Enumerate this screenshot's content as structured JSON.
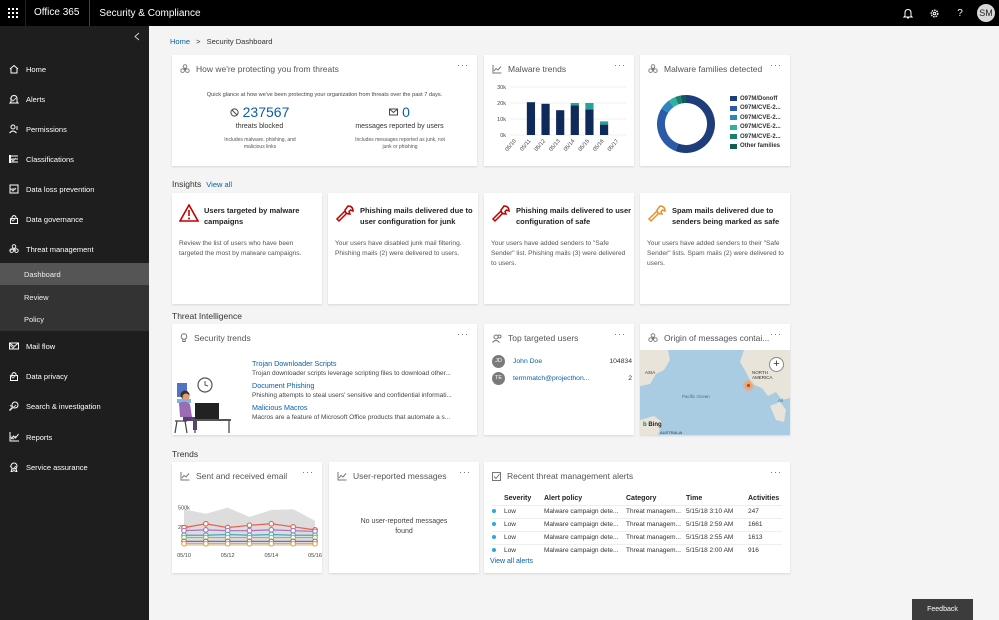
{
  "topbar": {
    "app_name": "Office 365",
    "suite_name": "Security & Compliance",
    "user_initials": "SM"
  },
  "sidebar": {
    "items": [
      {
        "label": "Home",
        "icon": "home-icon",
        "has_chevron": false
      },
      {
        "label": "Alerts",
        "icon": "alert-icon",
        "has_chevron": true
      },
      {
        "label": "Permissions",
        "icon": "permissions-icon",
        "has_chevron": false
      },
      {
        "label": "Classifications",
        "icon": "classifications-icon",
        "has_chevron": true
      },
      {
        "label": "Data loss prevention",
        "icon": "dlp-icon",
        "has_chevron": true
      },
      {
        "label": "Data governance",
        "icon": "lock-icon",
        "has_chevron": true
      },
      {
        "label": "Threat management",
        "icon": "biohazard-icon",
        "has_chevron": true,
        "expanded": true
      },
      {
        "label": "Mail flow",
        "icon": "mail-icon",
        "has_chevron": true
      },
      {
        "label": "Data privacy",
        "icon": "lock-icon",
        "has_chevron": true
      },
      {
        "label": "Search & investigation",
        "icon": "search-icon",
        "has_chevron": true
      },
      {
        "label": "Reports",
        "icon": "chart-icon",
        "has_chevron": true
      },
      {
        "label": "Service assurance",
        "icon": "badge-icon",
        "has_chevron": true
      }
    ],
    "subitems": [
      {
        "label": "Dashboard",
        "active": true
      },
      {
        "label": "Review",
        "active": false
      },
      {
        "label": "Policy",
        "active": false
      }
    ]
  },
  "breadcrumb": {
    "home": "Home",
    "sep": ">",
    "current": "Security Dashboard"
  },
  "protect": {
    "title": "How we're protecting you from threats",
    "intro": "Quick glance at how we've been protecting your organization from threats over the past 7 days.",
    "threats_blocked_value": "237567",
    "threats_blocked_label": "threats blocked",
    "threats_blocked_note": "Includes malware, phishing, and malicious links",
    "reported_value": "0",
    "reported_label": "messages reported by users",
    "reported_note": "Includes messages reported as junk, not junk or phishing"
  },
  "malware_trends": {
    "title": "Malware trends",
    "chart_data": {
      "type": "bar",
      "categories": [
        "05/10",
        "05/11",
        "05/12",
        "05/13",
        "05/14",
        "05/15",
        "05/16",
        "05/17"
      ],
      "ylim": [
        0,
        30000
      ],
      "yticks": [
        "30k",
        "20k",
        "10k",
        "0k"
      ],
      "series": [
        {
          "values": [
            0,
            20500,
            19500,
            15500,
            18500,
            16000,
            6500,
            0
          ],
          "color": "#0e2a5a"
        },
        {
          "values": [
            0,
            0,
            0,
            0,
            1500,
            4000,
            2000,
            0
          ],
          "color": "#2aa198"
        }
      ]
    }
  },
  "malware_families": {
    "title": "Malware families detected",
    "legend": [
      {
        "label": "O97M/Donoff",
        "color": "#1f3d7a"
      },
      {
        "label": "O97M/CVE-2...",
        "color": "#2b5aa8"
      },
      {
        "label": "O97M/CVE-2...",
        "color": "#2e86c1"
      },
      {
        "label": "O97M/CVE-2...",
        "color": "#2bb3a0"
      },
      {
        "label": "O97M/CVE-2...",
        "color": "#1a7f73"
      },
      {
        "label": "Other families",
        "color": "#0f5e55"
      }
    ],
    "chart_data": {
      "type": "pie",
      "labels": [
        "O97M/Donoff",
        "O97M/CVE-2...",
        "O97M/CVE-2...",
        "O97M/CVE-2...",
        "O97M/CVE-2...",
        "Other families"
      ],
      "values": [
        56,
        28,
        6,
        4,
        3,
        3
      ]
    }
  },
  "insights": {
    "title": "Insights",
    "view_all": "View all",
    "cards": [
      {
        "title": "Users targeted by malware campaigns",
        "text": "Review the list of users who have been targeted the most by malware campaigns.",
        "icon": "warning-icon",
        "color": "#c00000"
      },
      {
        "title": "Phishing mails delivered due to user configuration for junk",
        "text": "Your users have disabled junk mail filtering. Phishing mails (2) were delivered to users.",
        "icon": "wrench-icon",
        "color": "#c00000"
      },
      {
        "title": "Phishing mails delivered to user configuration of safe",
        "text": "Your users have added senders to \"Safe Sender\" list. Phishing mails (3) were delivered to users.",
        "icon": "wrench-icon",
        "color": "#c00000"
      },
      {
        "title": "Spam mails delivered due to senders being marked as safe",
        "text": "Your users have added senders to their \"Safe Sender\" lists. Spam mails (2) were delivered to users.",
        "icon": "wrench-icon",
        "color": "#e8912d"
      }
    ]
  },
  "threat_intel": {
    "title": "Threat Intelligence"
  },
  "security_trends": {
    "title": "Security trends",
    "items": [
      {
        "title": "Trojan Downloader Scripts",
        "desc": "Trojan downloader scripts leverage scripting files to download other..."
      },
      {
        "title": "Document Phishing",
        "desc": "Phishing attempts to steal users' sensitive and confidential informati..."
      },
      {
        "title": "Malicious Macros",
        "desc": "Macros are a feature of Microsoft Office products that automate a s..."
      }
    ]
  },
  "top_users": {
    "title": "Top targeted users",
    "users": [
      {
        "initials": "JD",
        "name": "John Doe",
        "count": "104834"
      },
      {
        "initials": "TE",
        "name": "termmatch@projecthon...",
        "count": "2"
      }
    ]
  },
  "origin": {
    "title": "Origin of messages contai...",
    "labels": {
      "asia": "ASIA",
      "north_america": "NORTH AMERICA",
      "pacific": "Pacific Ocean",
      "australia": "AUSTRALIA",
      "atl": "Atl",
      "bing": "Bing"
    }
  },
  "trends": {
    "title": "Trends"
  },
  "sent_received": {
    "title": "Sent and received email",
    "chart_data": {
      "type": "line",
      "x": [
        "05/10",
        "05/11",
        "05/12",
        "05/13",
        "05/14",
        "05/15",
        "05/16"
      ],
      "xticks": [
        "05/10",
        "05/12",
        "05/14",
        "05/16"
      ],
      "yticks": [
        "500k",
        "250k"
      ],
      "ylim": [
        0,
        600000
      ],
      "series": [
        {
          "color": "#cfcfcf",
          "values": [
            480000,
            420000,
            500000,
            380000,
            470000,
            480000,
            330000
          ],
          "area": true
        },
        {
          "color": "#e8604c",
          "values": [
            240000,
            290000,
            240000,
            270000,
            290000,
            250000,
            210000
          ]
        },
        {
          "color": "#b06fb5",
          "values": [
            200000,
            210000,
            200000,
            200000,
            210000,
            200000,
            190000
          ]
        },
        {
          "color": "#3fa9c9",
          "values": [
            140000,
            140000,
            150000,
            140000,
            150000,
            140000,
            140000
          ]
        },
        {
          "color": "#8cc63f",
          "values": [
            110000,
            110000,
            110000,
            110000,
            110000,
            110000,
            110000
          ]
        },
        {
          "color": "#9b59b6",
          "values": [
            60000,
            60000,
            60000,
            60000,
            60000,
            60000,
            60000
          ]
        },
        {
          "color": "#f0a030",
          "values": [
            30000,
            30000,
            30000,
            30000,
            30000,
            30000,
            30000
          ]
        }
      ]
    }
  },
  "user_reported": {
    "title": "User-reported messages",
    "empty": "No user-reported messages found"
  },
  "recent_alerts": {
    "title": "Recent threat management alerts",
    "columns": [
      "Severity",
      "Alert policy",
      "Category",
      "Time",
      "Activities"
    ],
    "rows": [
      [
        "Low",
        "Malware campaign dete...",
        "Threat managem...",
        "5/15/18 3:10 AM",
        "247"
      ],
      [
        "Low",
        "Malware campaign dete...",
        "Threat managem...",
        "5/15/18 2:59 AM",
        "1661"
      ],
      [
        "Low",
        "Malware campaign dete...",
        "Threat managem...",
        "5/15/18 2:55 AM",
        "1613"
      ],
      [
        "Low",
        "Malware campaign dete...",
        "Threat managem...",
        "5/15/18 2:00 AM",
        "916"
      ]
    ],
    "view_all": "View all alerts"
  },
  "feedback": "Feedback",
  "more": "···"
}
